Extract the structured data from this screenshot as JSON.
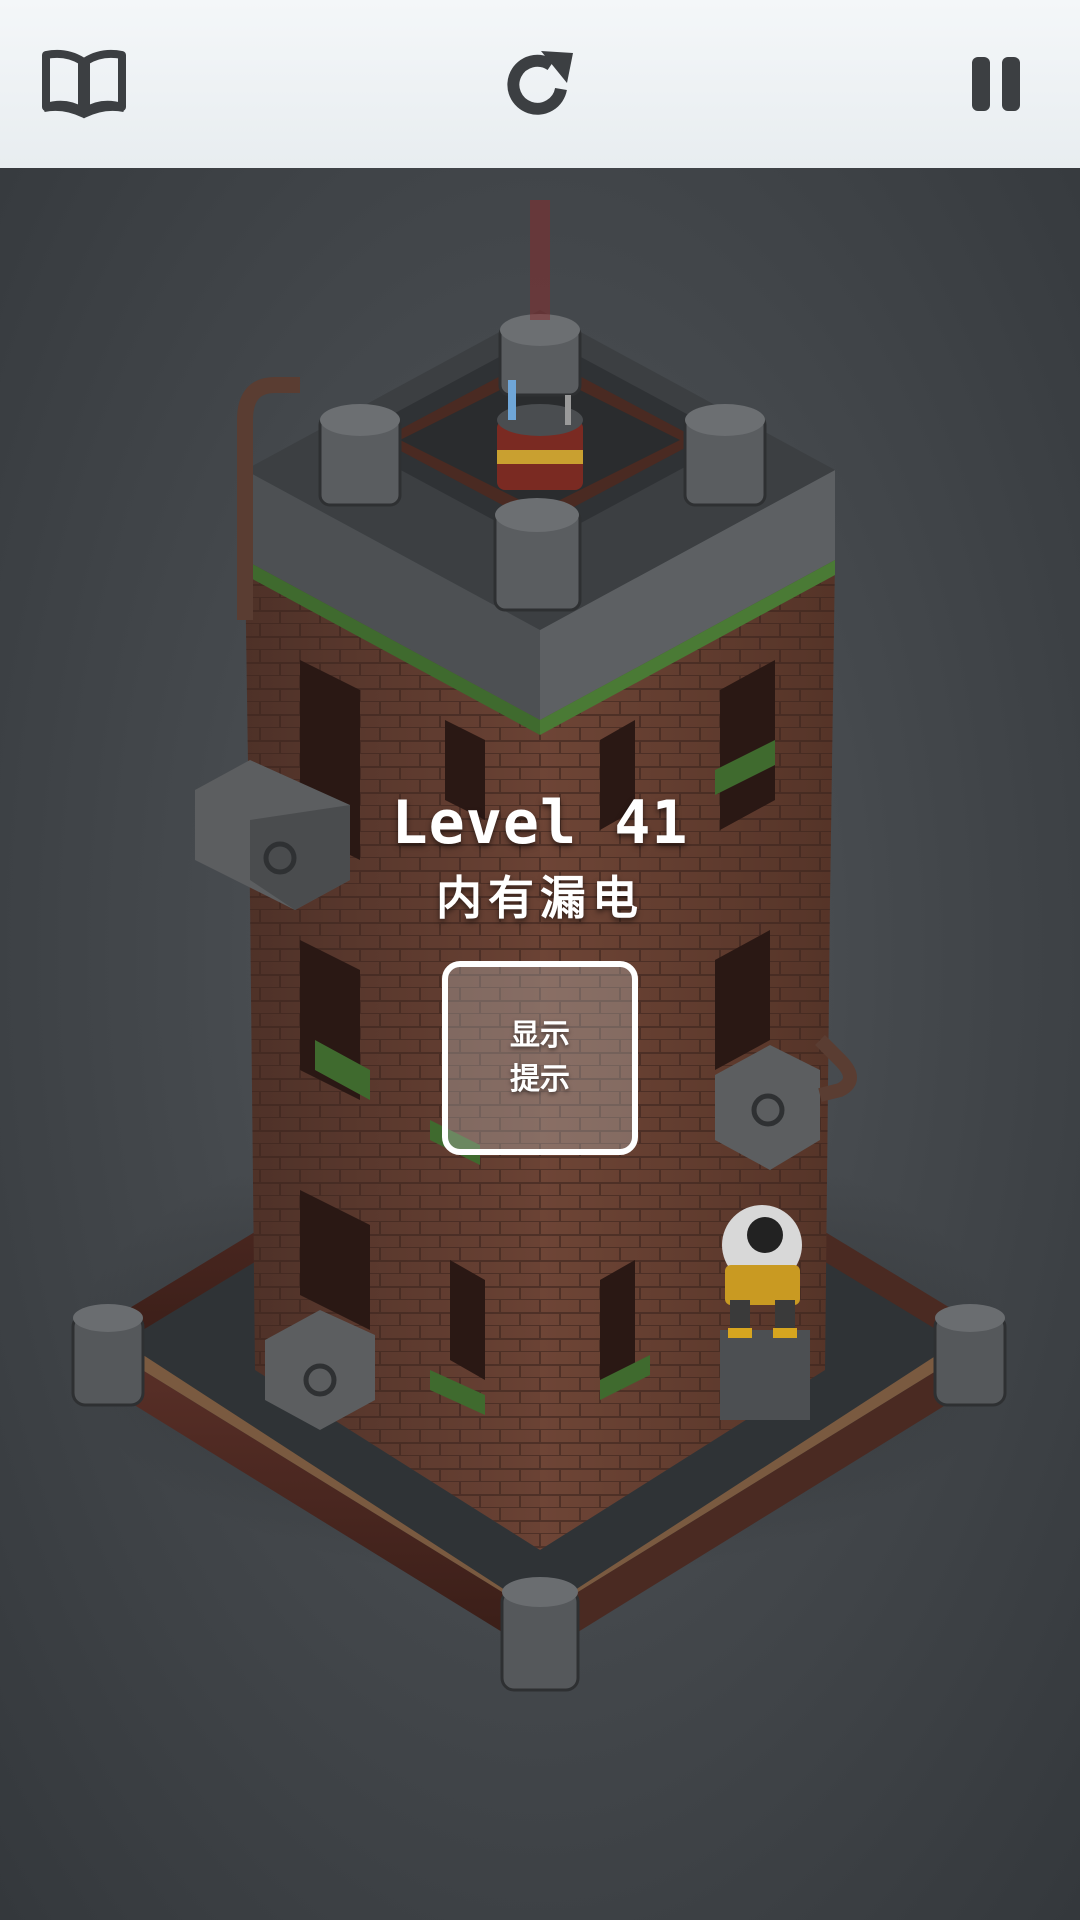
{
  "toolbar": {
    "guide_icon": "book-icon",
    "restart_icon": "restart-icon",
    "pause_icon": "pause-icon",
    "icon_color": "#3c3f42"
  },
  "level": {
    "title": "Level 41",
    "subtitle": "内有漏电"
  },
  "hint_button": {
    "line1": "显示",
    "line2": "提示"
  },
  "colors": {
    "topbar_bg": "#eef2f4",
    "scene_bg": "#45494d",
    "brick": "#6b4436",
    "stone": "#55585b",
    "moss": "#3f6a2e"
  }
}
